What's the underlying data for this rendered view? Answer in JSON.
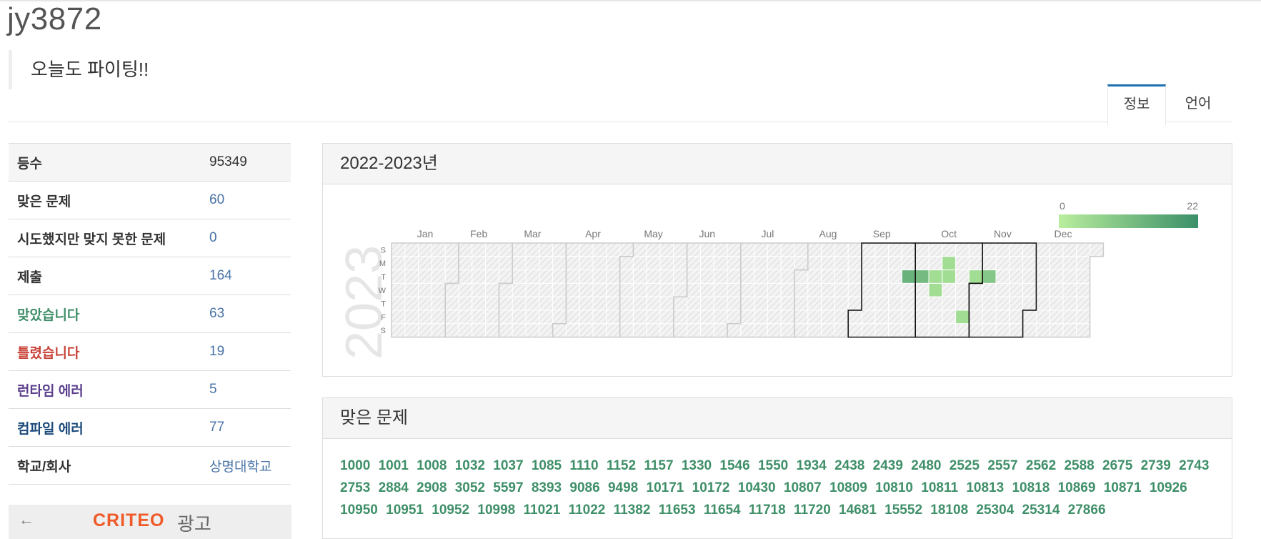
{
  "profile": {
    "username": "jy3872",
    "status_message": "오늘도 파이팅!!"
  },
  "tabs": [
    {
      "label": "정보",
      "active": true
    },
    {
      "label": "언어",
      "active": false
    }
  ],
  "stats": [
    {
      "label": "등수",
      "value": "95349",
      "label_color": "#333333",
      "linked": false
    },
    {
      "label": "맞은 문제",
      "value": "60",
      "label_color": "#333333",
      "linked": true
    },
    {
      "label": "시도했지만 맞지 못한 문제",
      "value": "0",
      "label_color": "#333333",
      "linked": true
    },
    {
      "label": "제출",
      "value": "164",
      "label_color": "#333333",
      "linked": true
    },
    {
      "label": "맞았습니다",
      "value": "63",
      "label_color": "#3f8f68",
      "linked": true
    },
    {
      "label": "틀렸습니다",
      "value": "19",
      "label_color": "#c9443a",
      "linked": true
    },
    {
      "label": "런타임 에러",
      "value": "5",
      "label_color": "#5b3f8c",
      "linked": true
    },
    {
      "label": "컴파일 에러",
      "value": "77",
      "label_color": "#1b4a7a",
      "linked": true
    },
    {
      "label": "학교/회사",
      "value": "상명대학교",
      "label_color": "#333333",
      "linked": true
    }
  ],
  "ad": {
    "brand": "CRITEO",
    "word": "광고"
  },
  "heatmap": {
    "title": "2022-2023년",
    "year_label": "2023",
    "year": 2023,
    "months": [
      "Jan",
      "Feb",
      "Mar",
      "Apr",
      "May",
      "Jun",
      "Jul",
      "Aug",
      "Sep",
      "Oct",
      "Nov",
      "Dec"
    ],
    "weekdays": [
      "S",
      "M",
      "T",
      "W",
      "T",
      "F",
      "S"
    ],
    "legend": {
      "min_label": "0",
      "max_label": "22",
      "low_color": "#b9ee9e",
      "high_color": "#3b8f68"
    },
    "highlighted_months": [
      9,
      10,
      11
    ],
    "active_days": [
      {
        "date": "2023-09-26",
        "count": 14
      },
      {
        "date": "2023-10-03",
        "count": 12
      },
      {
        "date": "2023-10-10",
        "count": 4
      },
      {
        "date": "2023-10-11",
        "count": 4
      },
      {
        "date": "2023-10-16",
        "count": 4
      },
      {
        "date": "2023-10-17",
        "count": 4
      },
      {
        "date": "2023-10-27",
        "count": 4
      },
      {
        "date": "2023-10-31",
        "count": 4
      },
      {
        "date": "2023-11-07",
        "count": 9
      }
    ]
  },
  "solved": {
    "title": "맞은 문제",
    "problems": [
      "1000",
      "1001",
      "1008",
      "1032",
      "1037",
      "1085",
      "1110",
      "1152",
      "1157",
      "1330",
      "1546",
      "1550",
      "1934",
      "2438",
      "2439",
      "2480",
      "2525",
      "2557",
      "2562",
      "2588",
      "2675",
      "2739",
      "2743",
      "2753",
      "2884",
      "2908",
      "3052",
      "5597",
      "8393",
      "9086",
      "9498",
      "10171",
      "10172",
      "10430",
      "10807",
      "10809",
      "10810",
      "10811",
      "10813",
      "10818",
      "10869",
      "10871",
      "10926",
      "10950",
      "10951",
      "10952",
      "10998",
      "11021",
      "11022",
      "11382",
      "11653",
      "11654",
      "11718",
      "11720",
      "14681",
      "15552",
      "18108",
      "25304",
      "25314",
      "27866"
    ]
  }
}
